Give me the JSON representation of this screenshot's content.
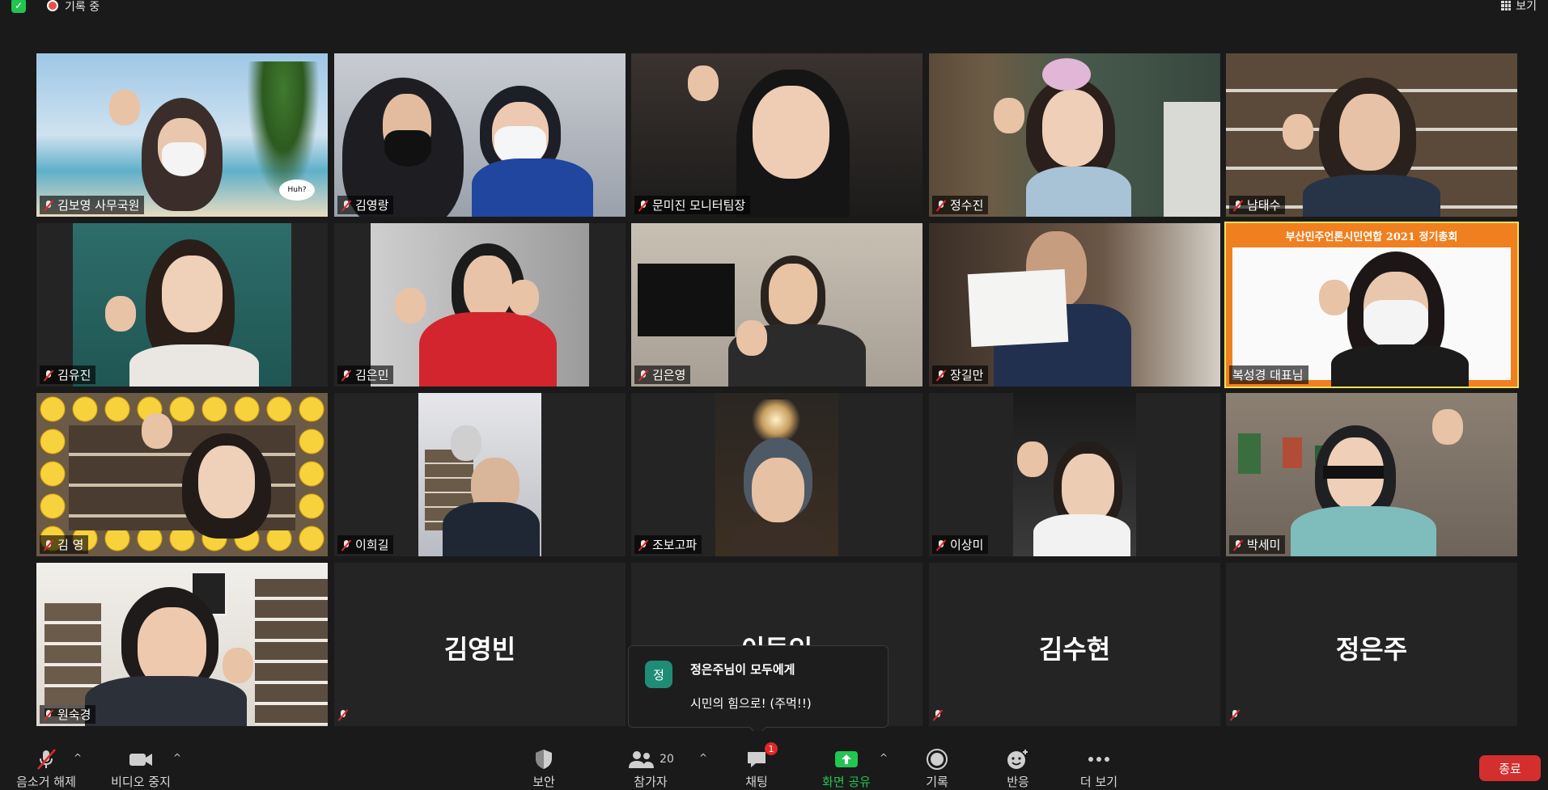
{
  "topbar": {
    "recording_label": "기록 중",
    "view_label": "보기"
  },
  "tiles": [
    {
      "name": "김보영 사무국원"
    },
    {
      "name": "김영랑"
    },
    {
      "name": "문미진 모니터팀장"
    },
    {
      "name": "정수진"
    },
    {
      "name": "남태수"
    },
    {
      "name": "김유진"
    },
    {
      "name": "김은민"
    },
    {
      "name": "김은영"
    },
    {
      "name": "장길만"
    },
    {
      "name": "복성경 대표님",
      "banner": "부산민주언론시민연합 2021 정기총회"
    },
    {
      "name": "김 영"
    },
    {
      "name": "이희길"
    },
    {
      "name": "조보고파"
    },
    {
      "name": "이상미"
    },
    {
      "name": "박세미"
    },
    {
      "name": "원숙경"
    },
    {
      "name": "김영빈"
    },
    {
      "name": "이동인"
    },
    {
      "name": "김수현"
    },
    {
      "name": "정은주"
    }
  ],
  "chat_popup": {
    "avatar_initial": "정",
    "sender": "정은주님이 모두에게",
    "message": "시민의 힘으로! (주먹!!)"
  },
  "toolbar": {
    "unmute": "음소거 해제",
    "stop_video": "비디오 중지",
    "security": "보안",
    "participants": "참가자",
    "participants_count": "20",
    "chat": "채팅",
    "chat_badge": "1",
    "share_screen": "화면 공유",
    "record": "기록",
    "reactions": "반응",
    "more": "더 보기",
    "end": "종료"
  },
  "colors": {
    "share_green": "#23c552",
    "end_red": "#d32f2f",
    "active_speaker": "#f1e05a"
  }
}
